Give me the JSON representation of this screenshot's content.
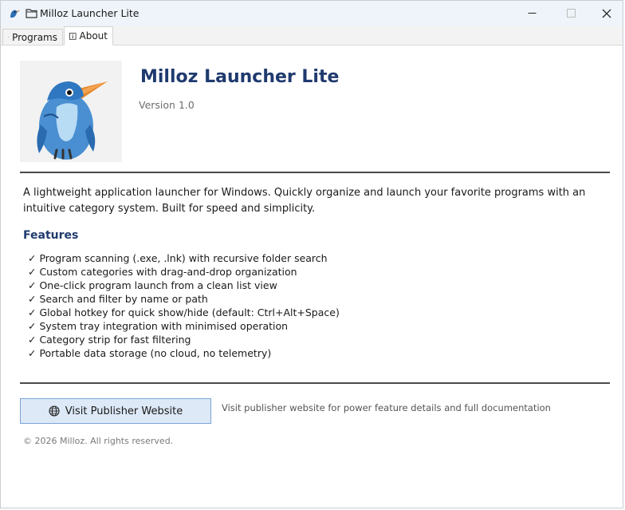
{
  "window": {
    "title": "Milloz Launcher Lite"
  },
  "tabs": [
    {
      "label": "Programs",
      "icon": "folder-icon",
      "active": false
    },
    {
      "label": "About",
      "icon": "info-icon",
      "active": true
    }
  ],
  "about": {
    "app_name": "Milloz Launcher Lite",
    "version": "Version 1.0",
    "logo_icon": "kingfisher-bird-logo",
    "description": "A lightweight application launcher for Windows. Quickly organize and launch your favorite programs with an intuitive category system. Built for speed and simplicity.",
    "features_title": "Features",
    "features": [
      "✓ Program scanning (.exe, .lnk) with recursive folder search",
      "✓ Custom categories with drag-and-drop organization",
      "✓ One-click program launch from a clean list view",
      "✓ Search and filter by name or path",
      "✓ Global hotkey for quick show/hide (default: Ctrl+Alt+Space)",
      "✓ System tray integration with minimised operation",
      "✓ Category strip for fast filtering",
      "✓ Portable data storage (no cloud, no telemetry)"
    ],
    "visit_button": "Visit Publisher Website",
    "visit_icon": "globe-icon",
    "visit_hint": "Visit publisher website for power feature details and full documentation",
    "copyright": "© 2026 Milloz. All rights reserved."
  },
  "colors": {
    "accent_title": "#1f3a6e",
    "button_bg": "#dde9f7",
    "button_border": "#7aa3d4"
  }
}
